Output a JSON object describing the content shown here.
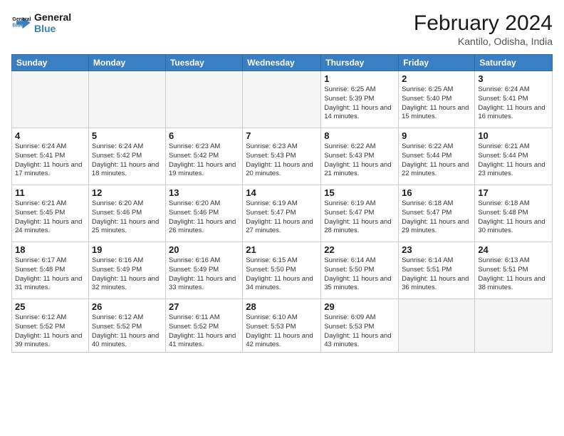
{
  "logo": {
    "line1": "General",
    "line2": "Blue"
  },
  "title": "February 2024",
  "subtitle": "Kantilo, Odisha, India",
  "days_header": [
    "Sunday",
    "Monday",
    "Tuesday",
    "Wednesday",
    "Thursday",
    "Friday",
    "Saturday"
  ],
  "weeks": [
    [
      {
        "num": "",
        "info": ""
      },
      {
        "num": "",
        "info": ""
      },
      {
        "num": "",
        "info": ""
      },
      {
        "num": "",
        "info": ""
      },
      {
        "num": "1",
        "info": "Sunrise: 6:25 AM\nSunset: 5:39 PM\nDaylight: 11 hours and 14 minutes."
      },
      {
        "num": "2",
        "info": "Sunrise: 6:25 AM\nSunset: 5:40 PM\nDaylight: 11 hours and 15 minutes."
      },
      {
        "num": "3",
        "info": "Sunrise: 6:24 AM\nSunset: 5:41 PM\nDaylight: 11 hours and 16 minutes."
      }
    ],
    [
      {
        "num": "4",
        "info": "Sunrise: 6:24 AM\nSunset: 5:41 PM\nDaylight: 11 hours and 17 minutes."
      },
      {
        "num": "5",
        "info": "Sunrise: 6:24 AM\nSunset: 5:42 PM\nDaylight: 11 hours and 18 minutes."
      },
      {
        "num": "6",
        "info": "Sunrise: 6:23 AM\nSunset: 5:42 PM\nDaylight: 11 hours and 19 minutes."
      },
      {
        "num": "7",
        "info": "Sunrise: 6:23 AM\nSunset: 5:43 PM\nDaylight: 11 hours and 20 minutes."
      },
      {
        "num": "8",
        "info": "Sunrise: 6:22 AM\nSunset: 5:43 PM\nDaylight: 11 hours and 21 minutes."
      },
      {
        "num": "9",
        "info": "Sunrise: 6:22 AM\nSunset: 5:44 PM\nDaylight: 11 hours and 22 minutes."
      },
      {
        "num": "10",
        "info": "Sunrise: 6:21 AM\nSunset: 5:44 PM\nDaylight: 11 hours and 23 minutes."
      }
    ],
    [
      {
        "num": "11",
        "info": "Sunrise: 6:21 AM\nSunset: 5:45 PM\nDaylight: 11 hours and 24 minutes."
      },
      {
        "num": "12",
        "info": "Sunrise: 6:20 AM\nSunset: 5:46 PM\nDaylight: 11 hours and 25 minutes."
      },
      {
        "num": "13",
        "info": "Sunrise: 6:20 AM\nSunset: 5:46 PM\nDaylight: 11 hours and 26 minutes."
      },
      {
        "num": "14",
        "info": "Sunrise: 6:19 AM\nSunset: 5:47 PM\nDaylight: 11 hours and 27 minutes."
      },
      {
        "num": "15",
        "info": "Sunrise: 6:19 AM\nSunset: 5:47 PM\nDaylight: 11 hours and 28 minutes."
      },
      {
        "num": "16",
        "info": "Sunrise: 6:18 AM\nSunset: 5:47 PM\nDaylight: 11 hours and 29 minutes."
      },
      {
        "num": "17",
        "info": "Sunrise: 6:18 AM\nSunset: 5:48 PM\nDaylight: 11 hours and 30 minutes."
      }
    ],
    [
      {
        "num": "18",
        "info": "Sunrise: 6:17 AM\nSunset: 5:48 PM\nDaylight: 11 hours and 31 minutes."
      },
      {
        "num": "19",
        "info": "Sunrise: 6:16 AM\nSunset: 5:49 PM\nDaylight: 11 hours and 32 minutes."
      },
      {
        "num": "20",
        "info": "Sunrise: 6:16 AM\nSunset: 5:49 PM\nDaylight: 11 hours and 33 minutes."
      },
      {
        "num": "21",
        "info": "Sunrise: 6:15 AM\nSunset: 5:50 PM\nDaylight: 11 hours and 34 minutes."
      },
      {
        "num": "22",
        "info": "Sunrise: 6:14 AM\nSunset: 5:50 PM\nDaylight: 11 hours and 35 minutes."
      },
      {
        "num": "23",
        "info": "Sunrise: 6:14 AM\nSunset: 5:51 PM\nDaylight: 11 hours and 36 minutes."
      },
      {
        "num": "24",
        "info": "Sunrise: 6:13 AM\nSunset: 5:51 PM\nDaylight: 11 hours and 38 minutes."
      }
    ],
    [
      {
        "num": "25",
        "info": "Sunrise: 6:12 AM\nSunset: 5:52 PM\nDaylight: 11 hours and 39 minutes."
      },
      {
        "num": "26",
        "info": "Sunrise: 6:12 AM\nSunset: 5:52 PM\nDaylight: 11 hours and 40 minutes."
      },
      {
        "num": "27",
        "info": "Sunrise: 6:11 AM\nSunset: 5:52 PM\nDaylight: 11 hours and 41 minutes."
      },
      {
        "num": "28",
        "info": "Sunrise: 6:10 AM\nSunset: 5:53 PM\nDaylight: 11 hours and 42 minutes."
      },
      {
        "num": "29",
        "info": "Sunrise: 6:09 AM\nSunset: 5:53 PM\nDaylight: 11 hours and 43 minutes."
      },
      {
        "num": "",
        "info": ""
      },
      {
        "num": "",
        "info": ""
      }
    ]
  ]
}
